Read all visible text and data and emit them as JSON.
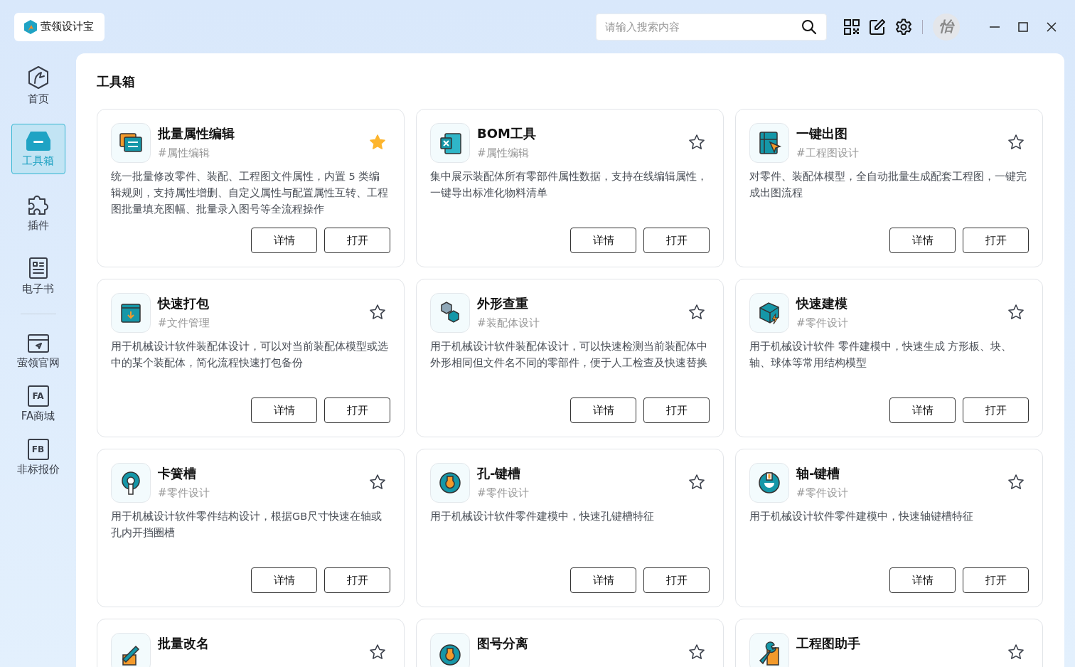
{
  "app": {
    "name": "萤领设计宝"
  },
  "search": {
    "placeholder": "请输入搜索内容"
  },
  "user": {
    "avatar_text": "怡"
  },
  "sidebar": {
    "items": [
      {
        "label": "首页",
        "selected": false
      },
      {
        "label": "工具箱",
        "selected": true
      },
      {
        "label": "插件",
        "selected": false
      },
      {
        "label": "电子书",
        "selected": false
      },
      {
        "kind": "divider"
      },
      {
        "label": "萤领官网",
        "selected": false
      },
      {
        "label": "FA商城",
        "selected": false,
        "icon_text": "FA"
      },
      {
        "label": "非标报价",
        "selected": false,
        "icon_text": "FB"
      }
    ]
  },
  "page": {
    "title": "工具箱"
  },
  "tools": [
    {
      "name": "批量属性编辑",
      "tag": "#属性编辑",
      "favorite": true,
      "description": "统一批量修改零件、装配、工程图文件属性，内置 5 类编辑规则，支持属性增删、自定义属性与配置属性互转、工程图批量填充图幅、批量录入图号等全流程操作",
      "buttons": [
        "详情",
        "打开"
      ]
    },
    {
      "name": "BOM工具",
      "tag": "#属性编辑",
      "favorite": false,
      "description": "集中展示装配体所有零部件属性数据，支持在线编辑属性，一键导出标准化物料清单",
      "buttons": [
        "详情",
        "打开"
      ]
    },
    {
      "name": "一键出图",
      "tag": "#工程图设计",
      "favorite": false,
      "description": "对零件、装配体模型，全自动批量生成配套工程图，一键完成出图流程",
      "buttons": [
        "详情",
        "打开"
      ]
    },
    {
      "name": "快速打包",
      "tag": "#文件管理",
      "favorite": false,
      "description": "用于机械设计软件装配体设计，可以对当前装配体模型或选中的某个装配体，简化流程快速打包备份",
      "buttons": [
        "详情",
        "打开"
      ]
    },
    {
      "name": "外形查重",
      "tag": "#装配体设计",
      "favorite": false,
      "description": "用于机械设计软件装配体设计，可以快速检测当前装配体中外形相同但文件名不同的零部件，便于人工检查及快速替换",
      "buttons": [
        "详情",
        "打开"
      ]
    },
    {
      "name": "快速建模",
      "tag": "#零件设计",
      "favorite": false,
      "description": "用于机械设计软件 零件建模中，快速生成 方形板、块、轴、球体等常用结构模型",
      "buttons": [
        "详情",
        "打开"
      ]
    },
    {
      "name": "卡簧槽",
      "tag": "#零件设计",
      "favorite": false,
      "description": "用于机械设计软件零件结构设计，根据GB尺寸快速在轴或孔内开挡圈槽",
      "buttons": [
        "详情",
        "打开"
      ]
    },
    {
      "name": "孔-键槽",
      "tag": "#零件设计",
      "favorite": false,
      "description": "用于机械设计软件零件建模中，快速孔键槽特征",
      "buttons": [
        "详情",
        "打开"
      ]
    },
    {
      "name": "轴-键槽",
      "tag": "#零件设计",
      "favorite": false,
      "description": "用于机械设计软件零件建模中，快速轴键槽特征",
      "buttons": [
        "详情",
        "打开"
      ]
    },
    {
      "name": "批量改名",
      "favorite": false
    },
    {
      "name": "图号分离",
      "favorite": false
    },
    {
      "name": "工程图助手",
      "favorite": false
    }
  ]
}
